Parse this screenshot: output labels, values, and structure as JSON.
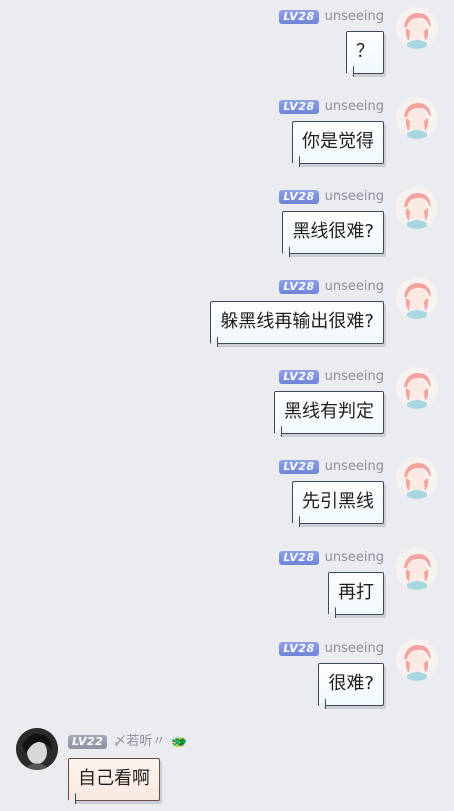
{
  "messages": [
    {
      "side": "self",
      "level": "LV28",
      "user": "unseeing",
      "text": "？"
    },
    {
      "side": "self",
      "level": "LV28",
      "user": "unseeing",
      "text": "你是觉得"
    },
    {
      "side": "self",
      "level": "LV28",
      "user": "unseeing",
      "text": "黑线很难?"
    },
    {
      "side": "self",
      "level": "LV28",
      "user": "unseeing",
      "text": "躲黑线再输出很难?"
    },
    {
      "side": "self",
      "level": "LV28",
      "user": "unseeing",
      "text": "黑线有判定"
    },
    {
      "side": "self",
      "level": "LV28",
      "user": "unseeing",
      "text": "先引黑线"
    },
    {
      "side": "self",
      "level": "LV28",
      "user": "unseeing",
      "text": "再打"
    },
    {
      "side": "self",
      "level": "LV28",
      "user": "unseeing",
      "text": "很难?"
    },
    {
      "side": "other",
      "level": "LV22",
      "user": "〆若听〃",
      "text": "自己看啊",
      "badge": "🐲"
    }
  ]
}
